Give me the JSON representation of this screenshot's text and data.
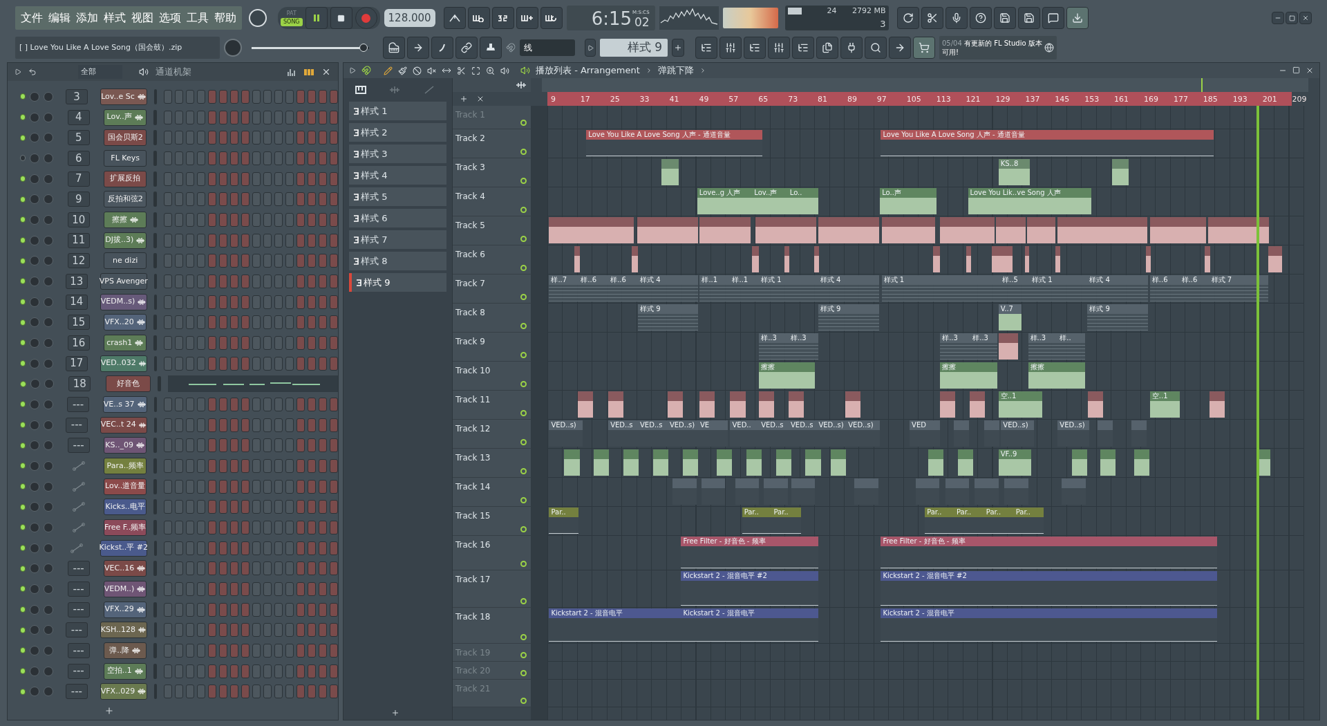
{
  "menu": [
    "文件",
    "编辑",
    "添加",
    "样式",
    "视图",
    "选项",
    "工具",
    "帮助"
  ],
  "hint": "[  ] Love You Like A Love Song（国会鼓）.zip",
  "mode_toggle": [
    {
      "label": "PAT",
      "selected": false
    },
    {
      "label": "SONG",
      "selected": true
    }
  ],
  "tempo": "128.000",
  "time": {
    "value": "6:15",
    "cs": "02",
    "unit": "M:S:CS"
  },
  "cpu": {
    "polyphony": "24",
    "memory": "2792 MB",
    "count": "3"
  },
  "master_volume": {
    "level": 0.95
  },
  "snap": "线",
  "pattern_selector": "样式 9",
  "news": {
    "date": "05/04",
    "text": "有更新的 FL Studio 版本可用!"
  },
  "channel_rack": {
    "filter": "全部",
    "title": "通道机架",
    "channels": [
      {
        "kind": "number",
        "number": "3",
        "name": "Lov..e Sc",
        "color": "#7a5852",
        "on": true,
        "sample": true
      },
      {
        "kind": "number",
        "number": "4",
        "name": "Lov..声",
        "color": "#5d7c57",
        "on": true,
        "sample": true
      },
      {
        "kind": "number",
        "number": "5",
        "name": "国会贝斯2",
        "color": "#7b4a48",
        "on": true,
        "sample": false
      },
      {
        "kind": "number",
        "number": "6",
        "name": "FL Keys",
        "color": "#48535c",
        "on": false,
        "sample": false
      },
      {
        "kind": "number",
        "number": "7",
        "name": "扩展反拍",
        "color": "#7b4a48",
        "on": true,
        "sample": false
      },
      {
        "kind": "number",
        "number": "9",
        "name": "反拍和弦2",
        "color": "#4c5760",
        "on": true,
        "sample": false
      },
      {
        "kind": "number",
        "number": "10",
        "name": "擦擦",
        "color": "#5d7c57",
        "on": true,
        "sample": true
      },
      {
        "kind": "number",
        "number": "11",
        "name": "DJ拔..3)",
        "color": "#5d7c57",
        "on": true,
        "sample": true
      },
      {
        "kind": "number",
        "number": "12",
        "name": "ne dizi",
        "color": "#48535c",
        "on": true,
        "sample": false
      },
      {
        "kind": "number",
        "number": "13",
        "name": "VPS Avenger",
        "color": "#48535c",
        "on": true,
        "sample": false
      },
      {
        "kind": "number",
        "number": "14",
        "name": "VEDM..s)",
        "color": "#675a7a",
        "on": true,
        "sample": true
      },
      {
        "kind": "number",
        "number": "15",
        "name": "VFX..20",
        "color": "#54647a",
        "on": true,
        "sample": true
      },
      {
        "kind": "number",
        "number": "16",
        "name": "crash1",
        "color": "#5d7c57",
        "on": true,
        "sample": true
      },
      {
        "kind": "number",
        "number": "17",
        "name": "VED..032",
        "color": "#4e7a68",
        "on": true,
        "sample": true
      },
      {
        "kind": "pianoroll",
        "number": "18",
        "name": "好音色",
        "color": "#7b4a48",
        "on": true,
        "sample": false
      },
      {
        "kind": "number",
        "number": "---",
        "name": "VE..s 37",
        "color": "#54647a",
        "on": true,
        "sample": true
      },
      {
        "kind": "number",
        "number": "---",
        "name": "VEC..t 24",
        "color": "#7b4a48",
        "on": true,
        "sample": true
      },
      {
        "kind": "number",
        "number": "---",
        "name": "KS.._09",
        "color": "#6f5575",
        "on": true,
        "sample": true
      },
      {
        "kind": "automation",
        "name": "Para..频率",
        "color": "#74803f",
        "on": true,
        "sample": false
      },
      {
        "kind": "automation",
        "name": "Lov..道音量",
        "color": "#8c4a4a",
        "on": true,
        "sample": false
      },
      {
        "kind": "automation",
        "name": "Kicks..电平",
        "color": "#4a5a8c",
        "on": true,
        "sample": false
      },
      {
        "kind": "automation",
        "name": "Free F..频率",
        "color": "#8c4a5a",
        "on": true,
        "sample": false
      },
      {
        "kind": "automation",
        "name": "Kickst..平 #2",
        "color": "#4a5a8c",
        "on": true,
        "sample": false
      },
      {
        "kind": "number",
        "number": "---",
        "name": "VEC..16",
        "color": "#7b4a48",
        "on": true,
        "sample": true
      },
      {
        "kind": "number",
        "number": "---",
        "name": "VEDM..)",
        "color": "#6f5575",
        "on": true,
        "sample": true
      },
      {
        "kind": "number",
        "number": "---",
        "name": "VFX..29",
        "color": "#54647a",
        "on": true,
        "sample": true
      },
      {
        "kind": "number",
        "number": "---",
        "name": "KSH..128",
        "color": "#6c6650",
        "on": true,
        "sample": true
      },
      {
        "kind": "number",
        "number": "---",
        "name": "弹..降",
        "color": "#6c5a4e",
        "on": true,
        "sample": true
      },
      {
        "kind": "number",
        "number": "---",
        "name": "空拍..1",
        "color": "#5d7c57",
        "on": true,
        "sample": true
      },
      {
        "kind": "number",
        "number": "---",
        "name": "VFX..029",
        "color": "#6a7a4f",
        "on": true,
        "sample": true
      }
    ]
  },
  "playlist": {
    "title": "播放列表 - Arrangement",
    "clip_name": "弹跳下降",
    "patterns": [
      {
        "label": "样式 1",
        "selected": false
      },
      {
        "label": "样式 2",
        "selected": false
      },
      {
        "label": "样式 3",
        "selected": false
      },
      {
        "label": "样式 4",
        "selected": false
      },
      {
        "label": "样式 5",
        "selected": false
      },
      {
        "label": "样式 6",
        "selected": false
      },
      {
        "label": "样式 7",
        "selected": false
      },
      {
        "label": "样式 8",
        "selected": false
      },
      {
        "label": "样式 9",
        "selected": true
      }
    ],
    "ruler": [
      "9",
      "17",
      "25",
      "33",
      "41",
      "49",
      "57",
      "65",
      "73",
      "81",
      "89",
      "97",
      "105",
      "113",
      "121",
      "129",
      "137",
      "145",
      "153",
      "161",
      "169",
      "177",
      "185",
      "193",
      "201",
      "209"
    ],
    "tracks": [
      {
        "name": "Track 1"
      },
      {
        "name": "Track 2",
        "clips": [
          {
            "kind": "automation",
            "color": "#b0565a",
            "label": "Love You Like A Love Song 人声 - 通道音量"
          },
          {
            "kind": "automation",
            "color": "#b0565a",
            "label": "Love You Like A Love Song 人声 - 通道音量"
          }
        ]
      },
      {
        "name": "Track 3",
        "clips": [
          {
            "kind": "audio",
            "color": "#6b8a6e"
          },
          {
            "kind": "audio",
            "color": "#6b8a6e",
            "label": "KS..8"
          },
          {
            "kind": "audio",
            "color": "#6b8a6e"
          }
        ]
      },
      {
        "name": "Track 4",
        "clips": [
          {
            "kind": "audio",
            "color": "#5f8660",
            "label": "Love..g 人声"
          },
          {
            "kind": "audio",
            "color": "#5f8660",
            "label": "Lov..声"
          },
          {
            "kind": "audio",
            "color": "#5f8660",
            "label": "Lo.."
          },
          {
            "kind": "audio",
            "color": "#5f8660",
            "label": "Lo..声"
          },
          {
            "kind": "audio",
            "color": "#5f8660",
            "label": "Love You Lik..ve Song 人声"
          }
        ]
      },
      {
        "name": "Track 5",
        "clips": [
          {
            "kind": "audio",
            "color": "#8a5a5e"
          },
          {
            "kind": "audio",
            "color": "#8a5a5e"
          },
          {
            "kind": "audio",
            "color": "#8a5a5e"
          },
          {
            "kind": "audio",
            "color": "#8a5a5e"
          },
          {
            "kind": "audio",
            "color": "#8a5a5e"
          },
          {
            "kind": "audio",
            "color": "#8a5a5e"
          },
          {
            "kind": "audio",
            "color": "#8a5a5e"
          },
          {
            "kind": "audio",
            "color": "#8a5a5e"
          },
          {
            "kind": "audio",
            "color": "#8a5a5e"
          },
          {
            "kind": "audio",
            "color": "#8a5a5e"
          },
          {
            "kind": "audio",
            "color": "#8a5a5e"
          },
          {
            "kind": "audio",
            "color": "#8a5a5e"
          }
        ]
      },
      {
        "name": "Track 6",
        "clips": [
          {
            "kind": "audio",
            "color": "#8a5a5e"
          },
          {
            "kind": "audio",
            "color": "#8a5a5e"
          },
          {
            "kind": "audio",
            "color": "#8a5a5e"
          },
          {
            "kind": "audio",
            "color": "#8a5a5e"
          },
          {
            "kind": "audio",
            "color": "#8a5a5e"
          },
          {
            "kind": "audio",
            "color": "#8a5a5e"
          },
          {
            "kind": "audio",
            "color": "#8a5a5e"
          },
          {
            "kind": "audio",
            "color": "#8a5a5e"
          },
          {
            "kind": "audio",
            "color": "#8a5a5e"
          },
          {
            "kind": "audio",
            "color": "#8a5a5e"
          },
          {
            "kind": "audio",
            "color": "#8a5a5e"
          },
          {
            "kind": "audio",
            "color": "#8a5a5e"
          },
          {
            "kind": "audio",
            "color": "#8a5a5e"
          }
        ]
      },
      {
        "name": "Track 7",
        "clips": [
          {
            "kind": "pattern",
            "label": "样..7"
          },
          {
            "kind": "pattern",
            "label": "样..6"
          },
          {
            "kind": "pattern",
            "label": "样..6"
          },
          {
            "kind": "pattern",
            "label": "样式 4"
          },
          {
            "kind": "pattern",
            "label": "样..1"
          },
          {
            "kind": "pattern",
            "label": "样..1"
          },
          {
            "kind": "pattern",
            "label": "样式 1"
          },
          {
            "kind": "pattern",
            "label": "样式 4"
          },
          {
            "kind": "pattern",
            "label": "样式 1"
          },
          {
            "kind": "pattern",
            "label": "样..5"
          },
          {
            "kind": "pattern",
            "label": "样式 1"
          },
          {
            "kind": "pattern",
            "label": "样式 4"
          },
          {
            "kind": "pattern",
            "label": "样..6"
          },
          {
            "kind": "pattern",
            "label": "样..6"
          },
          {
            "kind": "pattern",
            "label": "样式 7"
          }
        ]
      },
      {
        "name": "Track 8",
        "clips": [
          {
            "kind": "pattern",
            "label": "样式 9"
          },
          {
            "kind": "pattern",
            "label": "样式 9"
          },
          {
            "kind": "audio",
            "color": "#5a6670",
            "label": "V..7"
          },
          {
            "kind": "pattern",
            "label": "样式 9"
          }
        ]
      },
      {
        "name": "Track 9",
        "clips": [
          {
            "kind": "pattern",
            "label": "样..3"
          },
          {
            "kind": "pattern",
            "label": "样..3"
          },
          {
            "kind": "pattern",
            "label": "样..3"
          },
          {
            "kind": "pattern",
            "label": "样..3"
          },
          {
            "kind": "audio",
            "color": "#8a5a5e"
          },
          {
            "kind": "pattern",
            "label": "样..3"
          },
          {
            "kind": "pattern",
            "label": "样.."
          }
        ]
      },
      {
        "name": "Track 10",
        "clips": [
          {
            "kind": "audio",
            "color": "#5f8660",
            "label": "擦擦"
          },
          {
            "kind": "audio",
            "color": "#5f8660",
            "label": "擦擦"
          },
          {
            "kind": "audio",
            "color": "#5f8660",
            "label": "擦擦"
          }
        ]
      },
      {
        "name": "Track 11",
        "clips": [
          {
            "kind": "audio",
            "color": "#8a5a5e"
          },
          {
            "kind": "audio",
            "color": "#8a5a5e"
          },
          {
            "kind": "audio",
            "color": "#8a5a5e"
          },
          {
            "kind": "audio",
            "color": "#8a5a5e"
          },
          {
            "kind": "audio",
            "color": "#8a5a5e"
          },
          {
            "kind": "audio",
            "color": "#8a5a5e"
          },
          {
            "kind": "audio",
            "color": "#8a5a5e"
          },
          {
            "kind": "audio",
            "color": "#8a5a5e"
          },
          {
            "kind": "audio",
            "color": "#8a5a5e"
          },
          {
            "kind": "audio",
            "color": "#8a5a5e"
          },
          {
            "kind": "audio",
            "color": "#5f8660",
            "label": "空..1"
          },
          {
            "kind": "audio",
            "color": "#8a5a5e"
          },
          {
            "kind": "audio",
            "color": "#5f8660",
            "label": "空..1"
          },
          {
            "kind": "audio",
            "color": "#8a5a5e"
          }
        ]
      },
      {
        "name": "Track 12",
        "clips": [
          {
            "kind": "audio",
            "color": "#56626c",
            "label": "VED..s)"
          },
          {
            "kind": "audio",
            "color": "#56626c",
            "label": "VED..s"
          },
          {
            "kind": "audio",
            "color": "#56626c",
            "label": "VED..s"
          },
          {
            "kind": "audio",
            "color": "#56626c",
            "label": "VED..s)"
          },
          {
            "kind": "audio",
            "color": "#56626c",
            "label": "VE"
          },
          {
            "kind": "audio",
            "color": "#56626c",
            "label": "VED.."
          },
          {
            "kind": "audio",
            "color": "#56626c",
            "label": "VED..s"
          },
          {
            "kind": "audio",
            "color": "#56626c",
            "label": "VED..s"
          },
          {
            "kind": "audio",
            "color": "#56626c",
            "label": "VED..s)"
          },
          {
            "kind": "audio",
            "color": "#56626c",
            "label": "VED..s)"
          },
          {
            "kind": "audio",
            "color": "#56626c",
            "label": "VED"
          },
          {
            "kind": "audio",
            "color": "#56626c"
          },
          {
            "kind": "audio",
            "color": "#56626c"
          },
          {
            "kind": "audio",
            "color": "#56626c",
            "label": "VED..s)"
          },
          {
            "kind": "audio",
            "color": "#56626c",
            "label": "VED..s)"
          },
          {
            "kind": "audio",
            "color": "#56626c"
          },
          {
            "kind": "audio",
            "color": "#56626c"
          }
        ]
      },
      {
        "name": "Track 13",
        "clips": [
          {
            "kind": "audio",
            "color": "#5f8660"
          },
          {
            "kind": "audio",
            "color": "#5f8660"
          },
          {
            "kind": "audio",
            "color": "#5f8660"
          },
          {
            "kind": "audio",
            "color": "#5f8660"
          },
          {
            "kind": "audio",
            "color": "#5f8660"
          },
          {
            "kind": "audio",
            "color": "#5f8660"
          },
          {
            "kind": "audio",
            "color": "#5f8660"
          },
          {
            "kind": "audio",
            "color": "#5f8660"
          },
          {
            "kind": "audio",
            "color": "#5f8660"
          },
          {
            "kind": "audio",
            "color": "#5f8660"
          },
          {
            "kind": "audio",
            "color": "#5f8660"
          },
          {
            "kind": "audio",
            "color": "#5f8660"
          },
          {
            "kind": "audio",
            "color": "#5f8660",
            "label": "VF..9"
          },
          {
            "kind": "audio",
            "color": "#5f8660"
          },
          {
            "kind": "audio",
            "color": "#5f8660"
          },
          {
            "kind": "audio",
            "color": "#5f8660"
          },
          {
            "kind": "audio",
            "color": "#5f8660"
          }
        ]
      },
      {
        "name": "Track 14",
        "clips": [
          {
            "kind": "audio",
            "color": "#56626c"
          },
          {
            "kind": "audio",
            "color": "#56626c"
          },
          {
            "kind": "audio",
            "color": "#56626c"
          },
          {
            "kind": "audio",
            "color": "#56626c"
          },
          {
            "kind": "audio",
            "color": "#56626c"
          },
          {
            "kind": "audio",
            "color": "#56626c"
          },
          {
            "kind": "audio",
            "color": "#56626c"
          },
          {
            "kind": "audio",
            "color": "#56626c"
          },
          {
            "kind": "audio",
            "color": "#56626c"
          },
          {
            "kind": "audio",
            "color": "#56626c"
          },
          {
            "kind": "audio",
            "color": "#56626c"
          }
        ]
      },
      {
        "name": "Track 15",
        "clips": [
          {
            "kind": "automation",
            "color": "#74803f",
            "label": "Par.."
          },
          {
            "kind": "automation",
            "color": "#74803f",
            "label": "Par.."
          },
          {
            "kind": "automation",
            "color": "#74803f",
            "label": "Par.."
          },
          {
            "kind": "automation",
            "color": "#74803f",
            "label": "Par.."
          },
          {
            "kind": "automation",
            "color": "#74803f",
            "label": "Par.."
          },
          {
            "kind": "automation",
            "color": "#74803f",
            "label": "Par.."
          },
          {
            "kind": "automation",
            "color": "#74803f",
            "label": "Par.."
          }
        ]
      },
      {
        "name": "Track 16",
        "clips": [
          {
            "kind": "automation",
            "color": "#a8566a",
            "label": "Free Filter - 好音色 - 频率"
          },
          {
            "kind": "automation",
            "color": "#a8566a",
            "label": "Free Filter - 好音色 - 频率"
          }
        ]
      },
      {
        "name": "Track 17",
        "clips": [
          {
            "kind": "automation",
            "color": "#4d5890",
            "label": "Kickstart 2 - 混音电平 #2"
          },
          {
            "kind": "automation",
            "color": "#4d5890",
            "label": "Kickstart 2 - 混音电平 #2"
          }
        ]
      },
      {
        "name": "Track 18",
        "clips": [
          {
            "kind": "automation",
            "color": "#4d5890",
            "label": "Kickstart 2 - 混音电平"
          },
          {
            "kind": "automation",
            "color": "#4d5890",
            "label": "Kickstart 2 - 混音电平"
          },
          {
            "kind": "automation",
            "color": "#4d5890",
            "label": "Kickstart 2 - 混音电平"
          }
        ]
      },
      {
        "name": "Track 19"
      },
      {
        "name": "Track 20"
      },
      {
        "name": "Track 21"
      }
    ]
  }
}
